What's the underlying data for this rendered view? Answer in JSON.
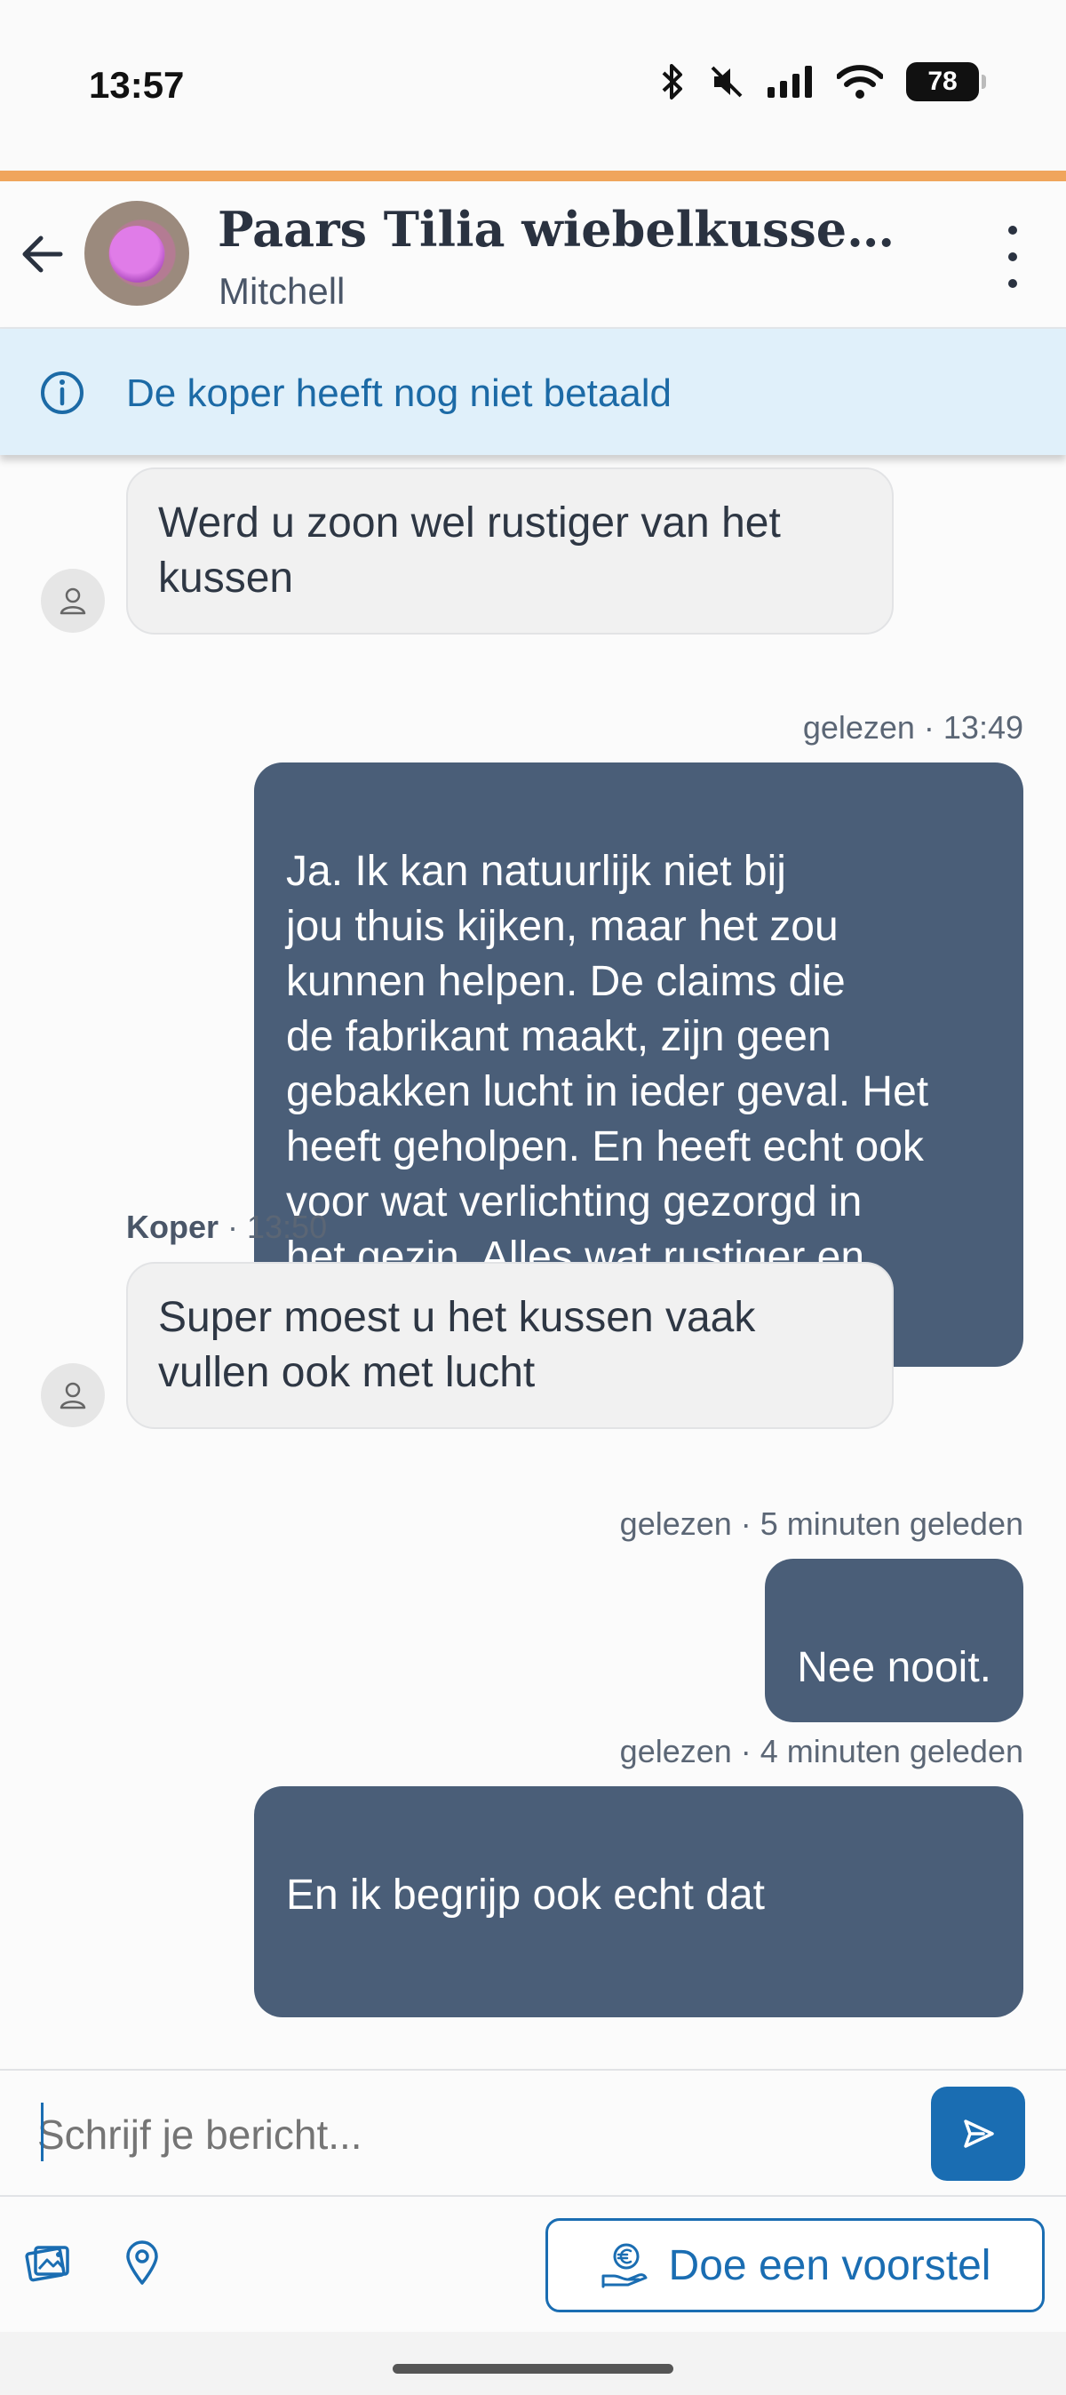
{
  "status_bar": {
    "time": "13:57",
    "battery": "78",
    "icons": [
      "bluetooth-icon",
      "mute-icon",
      "signal-icon",
      "wifi-icon",
      "battery-icon"
    ]
  },
  "header": {
    "title": "Paars Tilia wiebelkussen. Id...",
    "subtitle": "Mitchell",
    "back_icon": "back-arrow-icon",
    "menu_icon": "more-vertical-icon"
  },
  "notice": {
    "icon": "info-icon",
    "text": "De koper heeft nog niet betaald"
  },
  "messages": [
    {
      "direction": "in",
      "text": "Werd u zoon wel rustiger van het kussen"
    },
    {
      "direction": "out",
      "meta": "gelezen · 13:49",
      "text": "Ja. Ik kan natuurlijk niet bij\njou thuis kijken, maar het zou\nkunnen helpen. De claims die\nde fabrikant maakt, zijn geen\ngebakken lucht in ieder geval. Het\nheeft geholpen. En heeft echt ook\nvoor wat verlichting gezorgd in\nhet gezin. Alles wat rustiger en\nmeer licht, zou ik zeggen."
    },
    {
      "direction": "in",
      "sender": "Koper",
      "meta": " · 13:50",
      "text": "Super moest u het kussen vaak vullen ook met lucht"
    },
    {
      "direction": "out",
      "meta": "gelezen · 5 minuten geleden",
      "text": "Nee nooit."
    },
    {
      "direction": "out",
      "meta": "gelezen · 4 minuten geleden",
      "text": "En ik begrijp ook echt dat"
    }
  ],
  "composer": {
    "placeholder": "Schrijf je bericht...",
    "send_icon": "send-icon"
  },
  "toolbar": {
    "photo_icon": "photos-icon",
    "location_icon": "location-pin-icon",
    "offer_label": "Doe een voorstel",
    "offer_icon": "euro-hand-icon"
  },
  "colors": {
    "accent": "#f0a55c",
    "brand_blue": "#1a6db2",
    "outgoing_bubble": "#4a5e78",
    "incoming_bubble": "#f1f1f1",
    "notice_bg": "#e0f0fa"
  }
}
